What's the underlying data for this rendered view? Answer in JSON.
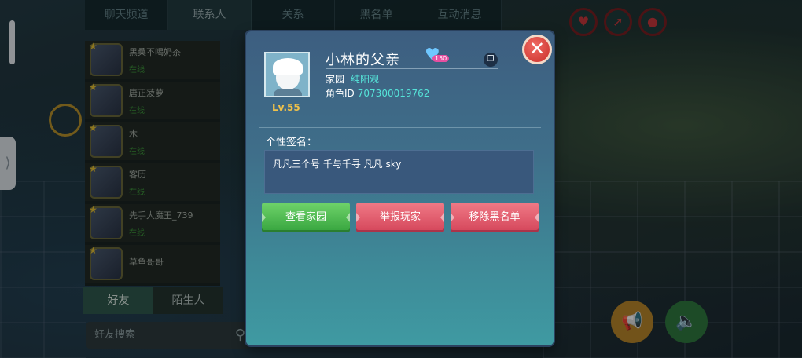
{
  "top_tabs": [
    "聊天频道",
    "联系人",
    "关系",
    "黑名单",
    "互动消息"
  ],
  "friends": [
    {
      "name": "黑桑不喝奶茶",
      "status": "在线"
    },
    {
      "name": "唐正菠萝",
      "status": "在线"
    },
    {
      "name": "木",
      "status": "在线"
    },
    {
      "name": "客历",
      "status": "在线"
    },
    {
      "name": "先手大魔王_739",
      "status": "在线"
    },
    {
      "name": "草鱼哥哥",
      "status": ""
    }
  ],
  "friend_tabs": [
    "好友",
    "陌生人"
  ],
  "friend_search_placeholder": "好友搜索",
  "profile": {
    "name": "小林的父亲",
    "level": "Lv.55",
    "heart_count": "150",
    "home_label": "家园",
    "home_value": "纯阳观",
    "role_id_label": "角色ID",
    "role_id_value": "707300019762"
  },
  "signature": {
    "label": "个性签名：",
    "text": "凡凡三个号 千与千寻 凡凡 sky"
  },
  "actions": {
    "view_home": "查看家园",
    "report_player": "举报玩家",
    "remove_blacklist": "移除黑名单"
  },
  "icons": {
    "close": "close-icon",
    "copy": "copy-icon",
    "heart": "heart-icon"
  }
}
